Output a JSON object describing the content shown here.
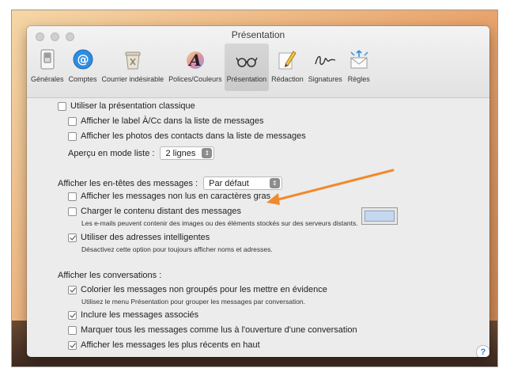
{
  "window": {
    "title": "Présentation"
  },
  "toolbar": {
    "items": [
      {
        "label": "Générales",
        "icon": "switch-icon"
      },
      {
        "label": "Comptes",
        "icon": "at-sign-icon"
      },
      {
        "label": "Courrier indésirable",
        "icon": "trash-bin-icon"
      },
      {
        "label": "Polices/Couleurs",
        "icon": "font-color-icon"
      },
      {
        "label": "Présentation",
        "icon": "glasses-icon",
        "active": true
      },
      {
        "label": "Rédaction",
        "icon": "pencil-icon"
      },
      {
        "label": "Signatures",
        "icon": "signature-icon"
      },
      {
        "label": "Règles",
        "icon": "envelope-arrows-icon"
      }
    ]
  },
  "options": {
    "classic_layout": "Utiliser la présentation classique",
    "show_to_cc": "Afficher le label À/Cc dans la liste de messages",
    "show_contact_photos": "Afficher les photos des contacts dans la liste de messages",
    "preview_label": "Aperçu en mode liste :",
    "preview_value": "2 lignes",
    "headers_label": "Afficher les en-têtes des messages :",
    "headers_value": "Par défaut",
    "unread_bold": "Afficher les messages non lus en caractères gras",
    "load_remote": "Charger le contenu distant des messages",
    "load_remote_hint": "Les e-mails peuvent contenir des images ou des éléments stockés sur des serveurs distants.",
    "smart_addresses": "Utiliser des adresses intelligentes",
    "smart_addresses_hint": "Désactivez cette option pour toujours afficher noms et adresses.",
    "conversations_label": "Afficher les conversations :",
    "color_ungrouped": "Colorier les messages non groupés pour les mettre en évidence",
    "color_ungrouped_hint": "Utilisez le menu Présentation pour grouper les messages par conversation.",
    "include_related": "Inclure les messages associés",
    "mark_read": "Marquer tous les messages comme lus à l'ouverture d'une conversation",
    "recent_top": "Afficher les messages les plus récents en haut"
  },
  "checked": {
    "classic_layout": false,
    "show_to_cc": false,
    "show_contact_photos": false,
    "unread_bold": false,
    "load_remote": false,
    "smart_addresses": true,
    "color_ungrouped": true,
    "include_related": true,
    "mark_read": false,
    "recent_top": true
  },
  "colors": {
    "arrow": "#f08a2c",
    "highlight_well": "#c6d8ef"
  },
  "help": {
    "label": "?"
  }
}
